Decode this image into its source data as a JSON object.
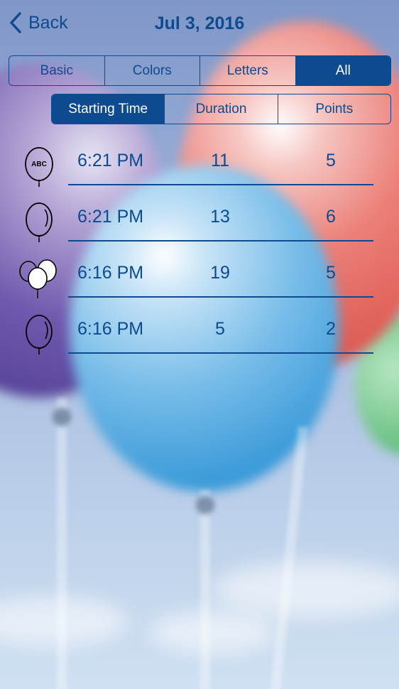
{
  "nav": {
    "back_label": "Back",
    "title": "Jul 3, 2016"
  },
  "category_tabs": [
    {
      "label": "Basic",
      "selected": false
    },
    {
      "label": "Colors",
      "selected": false
    },
    {
      "label": "Letters",
      "selected": false
    },
    {
      "label": "All",
      "selected": true
    }
  ],
  "sort_tabs": [
    {
      "label": "Starting Time",
      "selected": true
    },
    {
      "label": "Duration",
      "selected": false
    },
    {
      "label": "Points",
      "selected": false
    }
  ],
  "rows": [
    {
      "icon": "balloon-abc-icon",
      "icon_text": "ABC",
      "time": "6:21 PM",
      "duration": "11",
      "points": "5"
    },
    {
      "icon": "balloon-icon",
      "time": "6:21 PM",
      "duration": "13",
      "points": "6"
    },
    {
      "icon": "balloon-bunch-icon",
      "time": "6:16 PM",
      "duration": "19",
      "points": "5"
    },
    {
      "icon": "balloon-icon",
      "time": "6:16 PM",
      "duration": "5",
      "points": "2"
    }
  ],
  "colors": {
    "accent": "#0e4a8f",
    "selected_text": "#ffffff"
  }
}
